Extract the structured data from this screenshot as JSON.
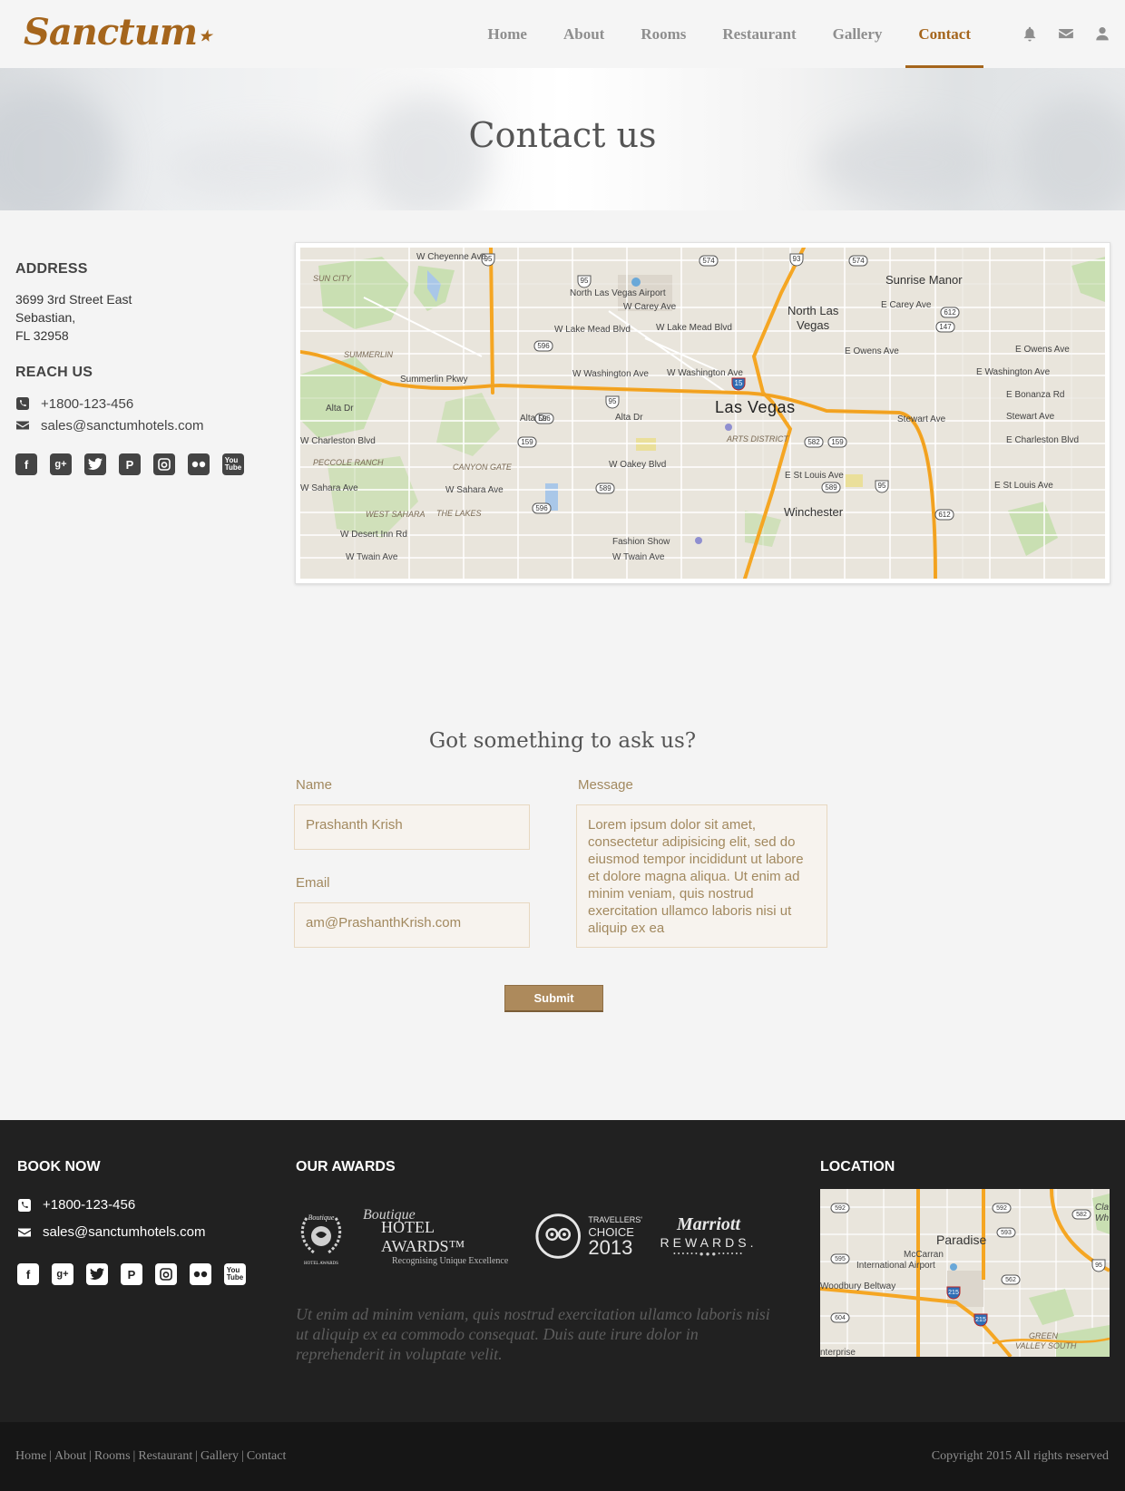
{
  "header": {
    "logo": "Sanctum",
    "nav": [
      "Home",
      "About",
      "Rooms",
      "Restaurant",
      "Gallery",
      "Contact"
    ],
    "active": "Contact",
    "icons": [
      "bell-icon",
      "envelope-icon",
      "user-icon"
    ]
  },
  "hero": {
    "title": "Contact us"
  },
  "info": {
    "address_heading": "ADDRESS",
    "address_lines": [
      "3699 3rd Street East",
      "Sebastian,",
      "FL 32958"
    ],
    "reach_heading": "REACH US",
    "phone": "+1800-123-456",
    "email": "sales@sanctumhotels.com",
    "socials": [
      "facebook-icon",
      "google-plus-icon",
      "twitter-icon",
      "pinterest-icon",
      "instagram-icon",
      "flickr-icon",
      "youtube-icon"
    ]
  },
  "map": {
    "labels": {
      "las_vegas": "Las Vegas",
      "north_las_vegas_1": "North Las",
      "north_las_vegas_2": "Vegas",
      "sunrise_manor": "Sunrise Manor",
      "winchester": "Winchester",
      "airport": "North Las Vegas Airport",
      "fashion_show": "Fashion Show",
      "sun_city": "SUN CITY",
      "summerlin": "SUMMERLIN",
      "peccole": "PECCOLE RANCH",
      "west_sahara": "WEST SAHARA",
      "canyon_gate": "CANYON GATE",
      "the_lakes": "THE LAKES",
      "arts": "ARTS DISTRICT",
      "summerlin_pkwy": "Summerlin Pkwy",
      "w_washington": "W Washington Ave",
      "e_washington": "E Washington Ave",
      "alta": "Alta Dr",
      "w_charleston": "W Charleston Blvd",
      "e_charleston": "E Charleston Blvd",
      "w_sahara": "W Sahara Ave",
      "e_st_louis": "E St Louis Ave",
      "w_oakey": "W Oakey Blvd",
      "w_lake_mead": "W Lake Mead Blvd",
      "w_carey": "W Carey Ave",
      "e_carey": "E Carey Ave",
      "w_cheyenne": "W Cheyenne Ave",
      "e_owens": "E Owens Ave",
      "w_desert_inn": "W Desert Inn Rd",
      "w_twain": "W Twain Ave",
      "stewart": "Stewart Ave",
      "e_bonanza": "E Bonanza Rd"
    },
    "shields": [
      "95",
      "574",
      "93",
      "15",
      "596",
      "159",
      "582",
      "589",
      "612",
      "147"
    ]
  },
  "form": {
    "title": "Got something to ask us?",
    "name_label": "Name",
    "name_value": "Prashanth Krish",
    "email_label": "Email",
    "email_value": "am@PrashanthKrish.com",
    "message_label": "Message",
    "message_value": "Lorem ipsum dolor sit amet, consectetur adipisicing elit, sed do eiusmod tempor incididunt ut labore et dolore magna aliqua. Ut enim ad minim veniam, quis nostrud exercitation ullamco laboris nisi ut aliquip ex ea",
    "submit": "Submit"
  },
  "footer": {
    "book_heading": "BOOK NOW",
    "phone": "+1800-123-456",
    "email": "sales@sanctumhotels.com",
    "awards_heading": "OUR AWARDS",
    "awards": {
      "boutique_small": "Boutique",
      "boutique_small_sub": "HOTEL AWARDS",
      "boutique_script": "Boutique",
      "boutique_title": "HOTEL AWARDS™",
      "boutique_sub": "Recognising Unique Excellence",
      "tripadvisor_brand": "tripadvisor",
      "travellers": "TRAVELLERS'",
      "choice": "CHOICE",
      "year": "2013",
      "marriott": "Marriott",
      "rewards": "REWARDS."
    },
    "quote": "Ut enim ad minim veniam, quis nostrud exercitation ullamco laboris nisi ut aliquip ex ea commodo consequat. Duis aute irure dolor in reprehenderit in voluptate velit.",
    "location_heading": "LOCATION",
    "mini_map": {
      "paradise": "Paradise",
      "airport_1": "McCarran",
      "airport_2": "International Airport",
      "woodbury": "Woodbury Beltway",
      "green_valley": "GREEN",
      "green_valley_2": "VALLEY SOUTH",
      "enterprise": "nterprise",
      "cla": "Cla",
      "wh": "Wh"
    }
  },
  "bottom": {
    "links": [
      "Home",
      "About",
      "Rooms",
      "Restaurant",
      "Gallery",
      "Contact"
    ],
    "copyright": "Copyright 2015 All rights reserved"
  },
  "colors": {
    "accent": "#a5651c",
    "tan": "#ad8a5c",
    "footer": "#212121"
  }
}
